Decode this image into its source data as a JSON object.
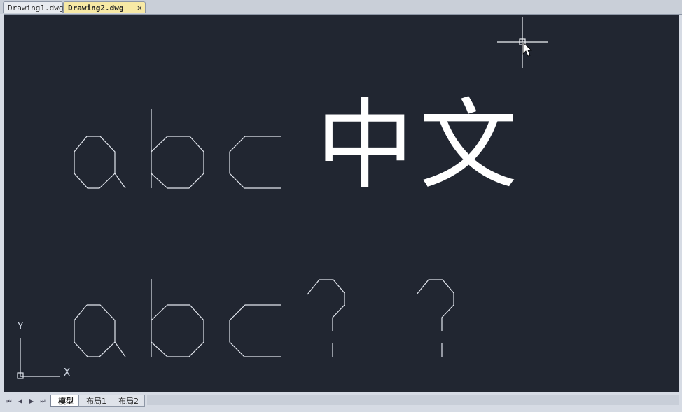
{
  "document_tabs": [
    {
      "label": "Drawing1.dwg",
      "active": false
    },
    {
      "label": "Drawing2.dwg",
      "active": true
    }
  ],
  "close_glyph": "✕",
  "canvas": {
    "background_color": "#212631",
    "geometry_color": "#e2e6ee",
    "cjk_text": [
      "中",
      "文"
    ],
    "ucs": {
      "y_label": "Y",
      "x_label": "X"
    }
  },
  "layout_nav_icons": [
    "first-icon",
    "prev-icon",
    "next-icon",
    "last-icon"
  ],
  "layout_nav_glyphs": [
    "⏮",
    "◀",
    "▶",
    "⏭"
  ],
  "layout_tabs": [
    {
      "label": "模型",
      "active": true
    },
    {
      "label": "布局1",
      "active": false
    },
    {
      "label": "布局2",
      "active": false
    }
  ]
}
